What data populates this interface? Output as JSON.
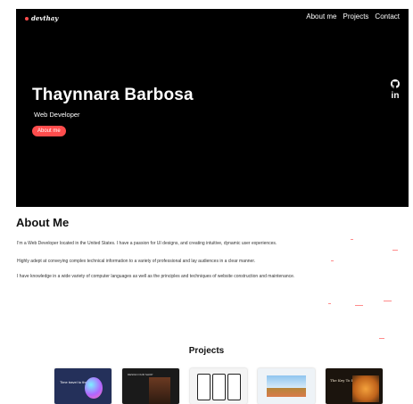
{
  "header": {
    "logo_text": "devthay",
    "nav": [
      "About me",
      "Projects",
      "Contact"
    ]
  },
  "hero": {
    "name": "Thaynnara Barbosa",
    "role": "Web Developer",
    "button_label": "About me",
    "social_icons": [
      "github-icon",
      "linkedin-icon"
    ],
    "linkedin_glyph": "in"
  },
  "about": {
    "title": "About Me",
    "paragraphs": [
      "I'm a Web Developer located in the United States. I have a passion for UI designs, and creating intuitive, dynamic user experiences.",
      "Highly adept at conveying complex technical information to a variety of professional and lay audiences in a clear manner.",
      "I have knowledge in a wide variety of computer languages as well as the principles and techniques of website construction and maintenance."
    ]
  },
  "projects": {
    "title": "Projects",
    "cards": [
      {
        "caption": "Time travel to the future."
      },
      {
        "caption": "DESIGN OUR SHOP"
      },
      {
        "caption": ""
      },
      {
        "caption": ""
      },
      {
        "caption": "The Key To Fine"
      }
    ]
  },
  "colors": {
    "accent": "#ff4d4d",
    "hero_background": "#000000",
    "page_background": "#ffffff"
  }
}
